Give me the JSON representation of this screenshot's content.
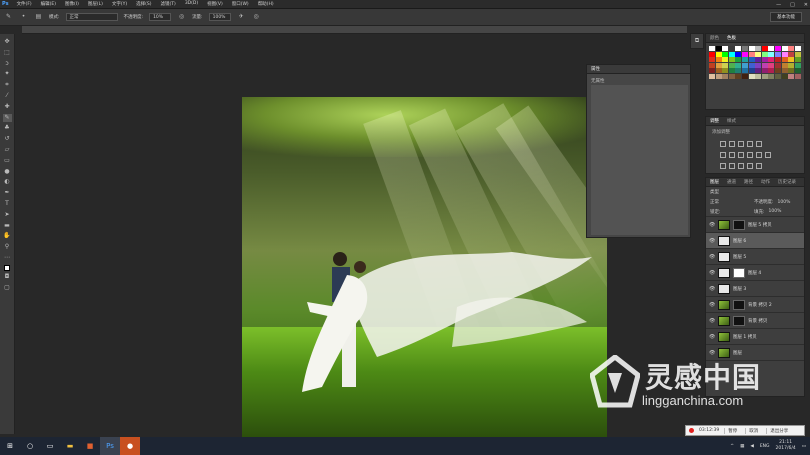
{
  "app": {
    "logo": "Ps",
    "menu": [
      "文件(F)",
      "编辑(E)",
      "图像(I)",
      "图层(L)",
      "文字(Y)",
      "选择(S)",
      "滤镜(T)",
      "3D(D)",
      "视图(V)",
      "窗口(W)",
      "帮助(H)"
    ],
    "window_controls": [
      "—",
      "□",
      "✕"
    ]
  },
  "options_bar": {
    "mode_label": "模式:",
    "mode_value": "正常",
    "opacity_label": "不透明度:",
    "opacity_value": "10%",
    "flow_label": "流量:",
    "flow_value": "100%",
    "workspace": "基本功能"
  },
  "properties_panel": {
    "title": "属性",
    "empty_text": "无属性"
  },
  "swatches_panel": {
    "tabs": [
      "颜色",
      "色板"
    ],
    "active_tab": 1,
    "colors": [
      "#ffffff",
      "#000000",
      "#ffffff",
      "#3a3a3a",
      "#ffffff",
      "#777777",
      "#ffffff",
      "#bbbbbb",
      "#ff0000",
      "#ffffff",
      "#ff00ff",
      "#ffffff",
      "#ff8080",
      "#ffffff",
      "#ff0000",
      "#ffff00",
      "#00ff00",
      "#00ffff",
      "#0000ff",
      "#ff00ff",
      "#ff8080",
      "#ffff80",
      "#80ff80",
      "#80ffff",
      "#8080ff",
      "#ff80ff",
      "#c04040",
      "#c0c040",
      "#e0301e",
      "#f08010",
      "#f0f020",
      "#80c020",
      "#20a040",
      "#20a0a0",
      "#2060c0",
      "#6020a0",
      "#a020a0",
      "#e02070",
      "#c02020",
      "#e06020",
      "#f0c020",
      "#60a020",
      "#c04020",
      "#e0a040",
      "#d0d050",
      "#50b050",
      "#30b090",
      "#40a0d0",
      "#4060d0",
      "#8040c0",
      "#c040b0",
      "#e04080",
      "#a03030",
      "#c08030",
      "#b0b030",
      "#30a060",
      "#802020",
      "#a06020",
      "#909020",
      "#208040",
      "#208070",
      "#2070a0",
      "#204090",
      "#602080",
      "#902070",
      "#b02050",
      "#704020",
      "#906030",
      "#707020",
      "#206030",
      "#e0c0a0",
      "#c0a080",
      "#a08060",
      "#806040",
      "#604020",
      "#402010",
      "#e0e0c0",
      "#c0c0a0",
      "#a0a080",
      "#808060",
      "#606040",
      "#404020",
      "#c08080",
      "#a06060"
    ]
  },
  "adjustments_panel": {
    "tabs": [
      "调整",
      "样式"
    ],
    "active_tab": 0,
    "title": "添加调整"
  },
  "layers_panel": {
    "tabs": [
      "图层",
      "通道",
      "路径",
      "动作",
      "历史记录"
    ],
    "active_tab": 0,
    "filter_label": "类型",
    "blend_mode": "正常",
    "opacity_label": "不透明度:",
    "opacity_value": "100%",
    "lock_label": "锁定:",
    "fill_label": "填充:",
    "fill_value": "100%",
    "layers": [
      {
        "name": "图层 5 拷贝",
        "thumb": "photo",
        "mask": "black",
        "selected": false
      },
      {
        "name": "图层 6",
        "thumb": "plain",
        "mask": "none",
        "selected": true
      },
      {
        "name": "图层 5",
        "thumb": "plain",
        "mask": "none",
        "selected": false
      },
      {
        "name": "图层 4",
        "thumb": "plain",
        "mask": "white",
        "selected": false
      },
      {
        "name": "图层 3",
        "thumb": "plain",
        "mask": "none",
        "selected": false
      },
      {
        "name": "背景 拷贝 2",
        "thumb": "photo",
        "mask": "black",
        "selected": false
      },
      {
        "name": "背景 拷贝",
        "thumb": "photo",
        "mask": "black",
        "selected": false
      },
      {
        "name": "图层 1 拷贝",
        "thumb": "photo",
        "mask": "none",
        "selected": false
      },
      {
        "name": "图层",
        "thumb": "photo",
        "mask": "none",
        "selected": false
      }
    ]
  },
  "recording": {
    "time": "03:12:39",
    "pause": "暂停",
    "stop": "取消",
    "exit": "退出分享"
  },
  "watermark": {
    "brand": "灵感中国",
    "url": "lingganchina.com"
  },
  "taskbar": {
    "lang": "ENG",
    "time": "21:11",
    "date": "2017/6/4"
  }
}
